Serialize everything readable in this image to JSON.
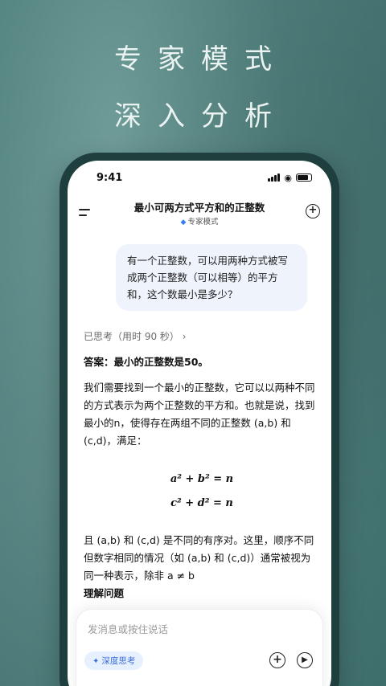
{
  "hero": {
    "line1": "专家模式",
    "line2": "深入分析"
  },
  "status_bar": {
    "time": "9:41"
  },
  "header": {
    "title": "最小可两方式平方和的正整数",
    "mode_label": "专家模式",
    "mode_icon": "diamond-icon"
  },
  "chat": {
    "user_message": "有一个正整数，可以用两种方式被写成两个正整数（可以相等）的平方和，这个数最小是多少？",
    "thought_label": "已思考（用时 90 秒）",
    "answer_heading": "答案：最小的正整数是50。",
    "paragraph1": "我们需要找到一个最小的正整数，它可以以两种不同的方式表示为两个正整数的平方和。也就是说，找到最小的n，使得存在两组不同的正整数 (a,b) 和 (c,d)，满足：",
    "formula1": "a² + b² = n",
    "formula2": "c² + d² = n",
    "paragraph2": "且 (a,b) 和 (c,d) 是不同的有序对。这里，顺序不同但数字相同的情况（如 (a,b) 和 (c,d)）通常被视为同一种表示，除非 a ≠ b",
    "section_heading": "理解问题"
  },
  "composer": {
    "placeholder": "发消息或按住说话",
    "deep_think_label": "深度思考",
    "colors": {
      "accent": "#3a6fd8",
      "accent_bg": "#e7f0fe"
    }
  }
}
